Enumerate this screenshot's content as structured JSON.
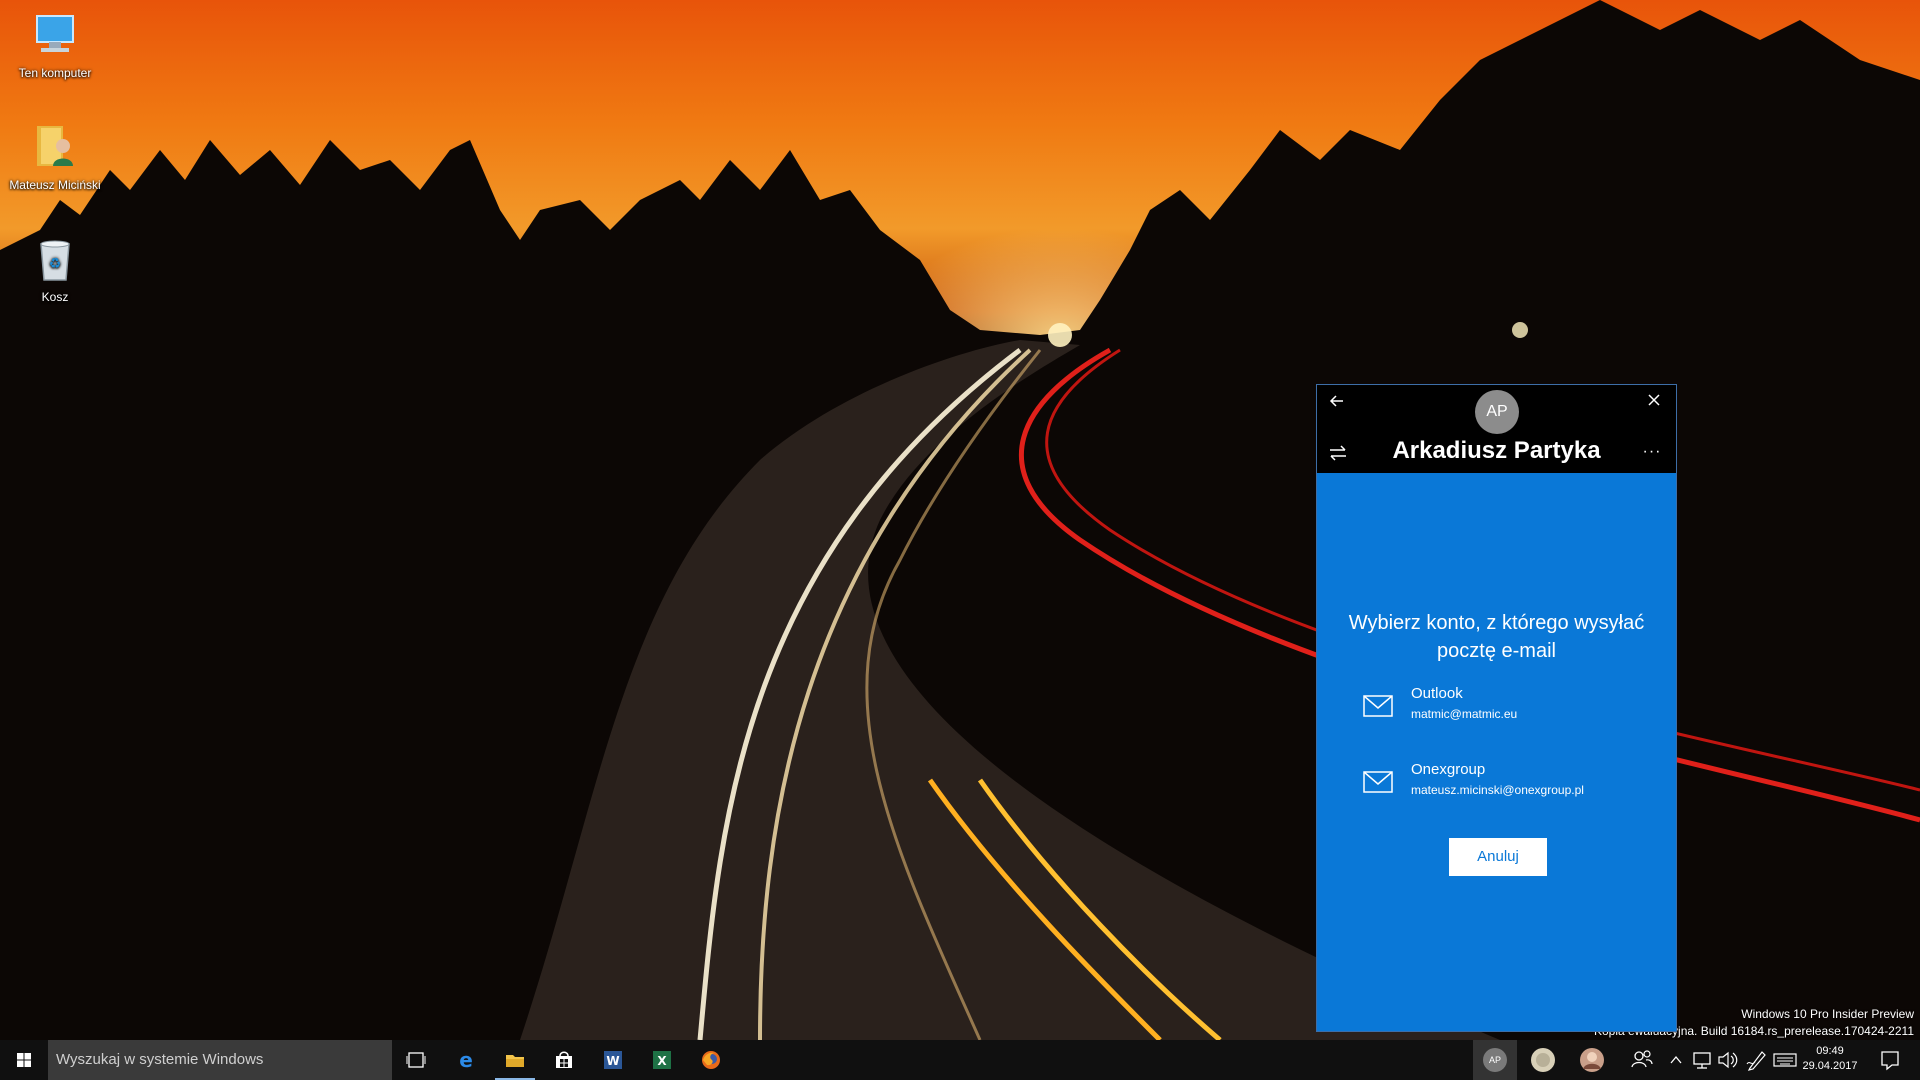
{
  "desktop": {
    "icons": [
      {
        "label": "Ten komputer",
        "icon": "computer-icon"
      },
      {
        "label": "Mateusz Miciński",
        "icon": "user-folder-icon"
      },
      {
        "label": "Kosz",
        "icon": "recycle-bin-icon"
      }
    ],
    "watermark": {
      "line1": "Windows 10 Pro Insider Preview",
      "line2": "Kopia ewaluacyjna. Build 16184.rs_prerelease.170424-2211"
    }
  },
  "dialog": {
    "avatar_initials": "AP",
    "user_name": "Arkadiusz Partyka",
    "back_icon": "back-arrow-icon",
    "close_icon": "close-icon",
    "switch_icon": "switch-accounts-icon",
    "more_label": "···",
    "prompt": "Wybierz konto, z którego wysyłać pocztę e-mail",
    "accounts": [
      {
        "name": "Outlook",
        "email": "matmic@matmic.eu"
      },
      {
        "name": "Onexgroup",
        "email": "mateusz.micinski@onexgroup.pl"
      }
    ],
    "cancel_label": "Anuluj",
    "colors": {
      "accent": "#0a78d7",
      "header": "#000000"
    }
  },
  "taskbar": {
    "search_placeholder": "Wyszukaj w systemie Windows",
    "apps": [
      "task-view-icon",
      "edge-icon",
      "file-explorer-icon",
      "store-icon",
      "word-icon",
      "excel-icon",
      "firefox-icon"
    ],
    "people": [
      {
        "initials": "AP"
      }
    ],
    "tray": [
      "people-icon",
      "chevron-up-icon",
      "network-icon",
      "volume-icon",
      "pen-icon",
      "keyboard-icon",
      "action-center-icon"
    ],
    "time": "09:49",
    "date": "29.04.2017"
  }
}
